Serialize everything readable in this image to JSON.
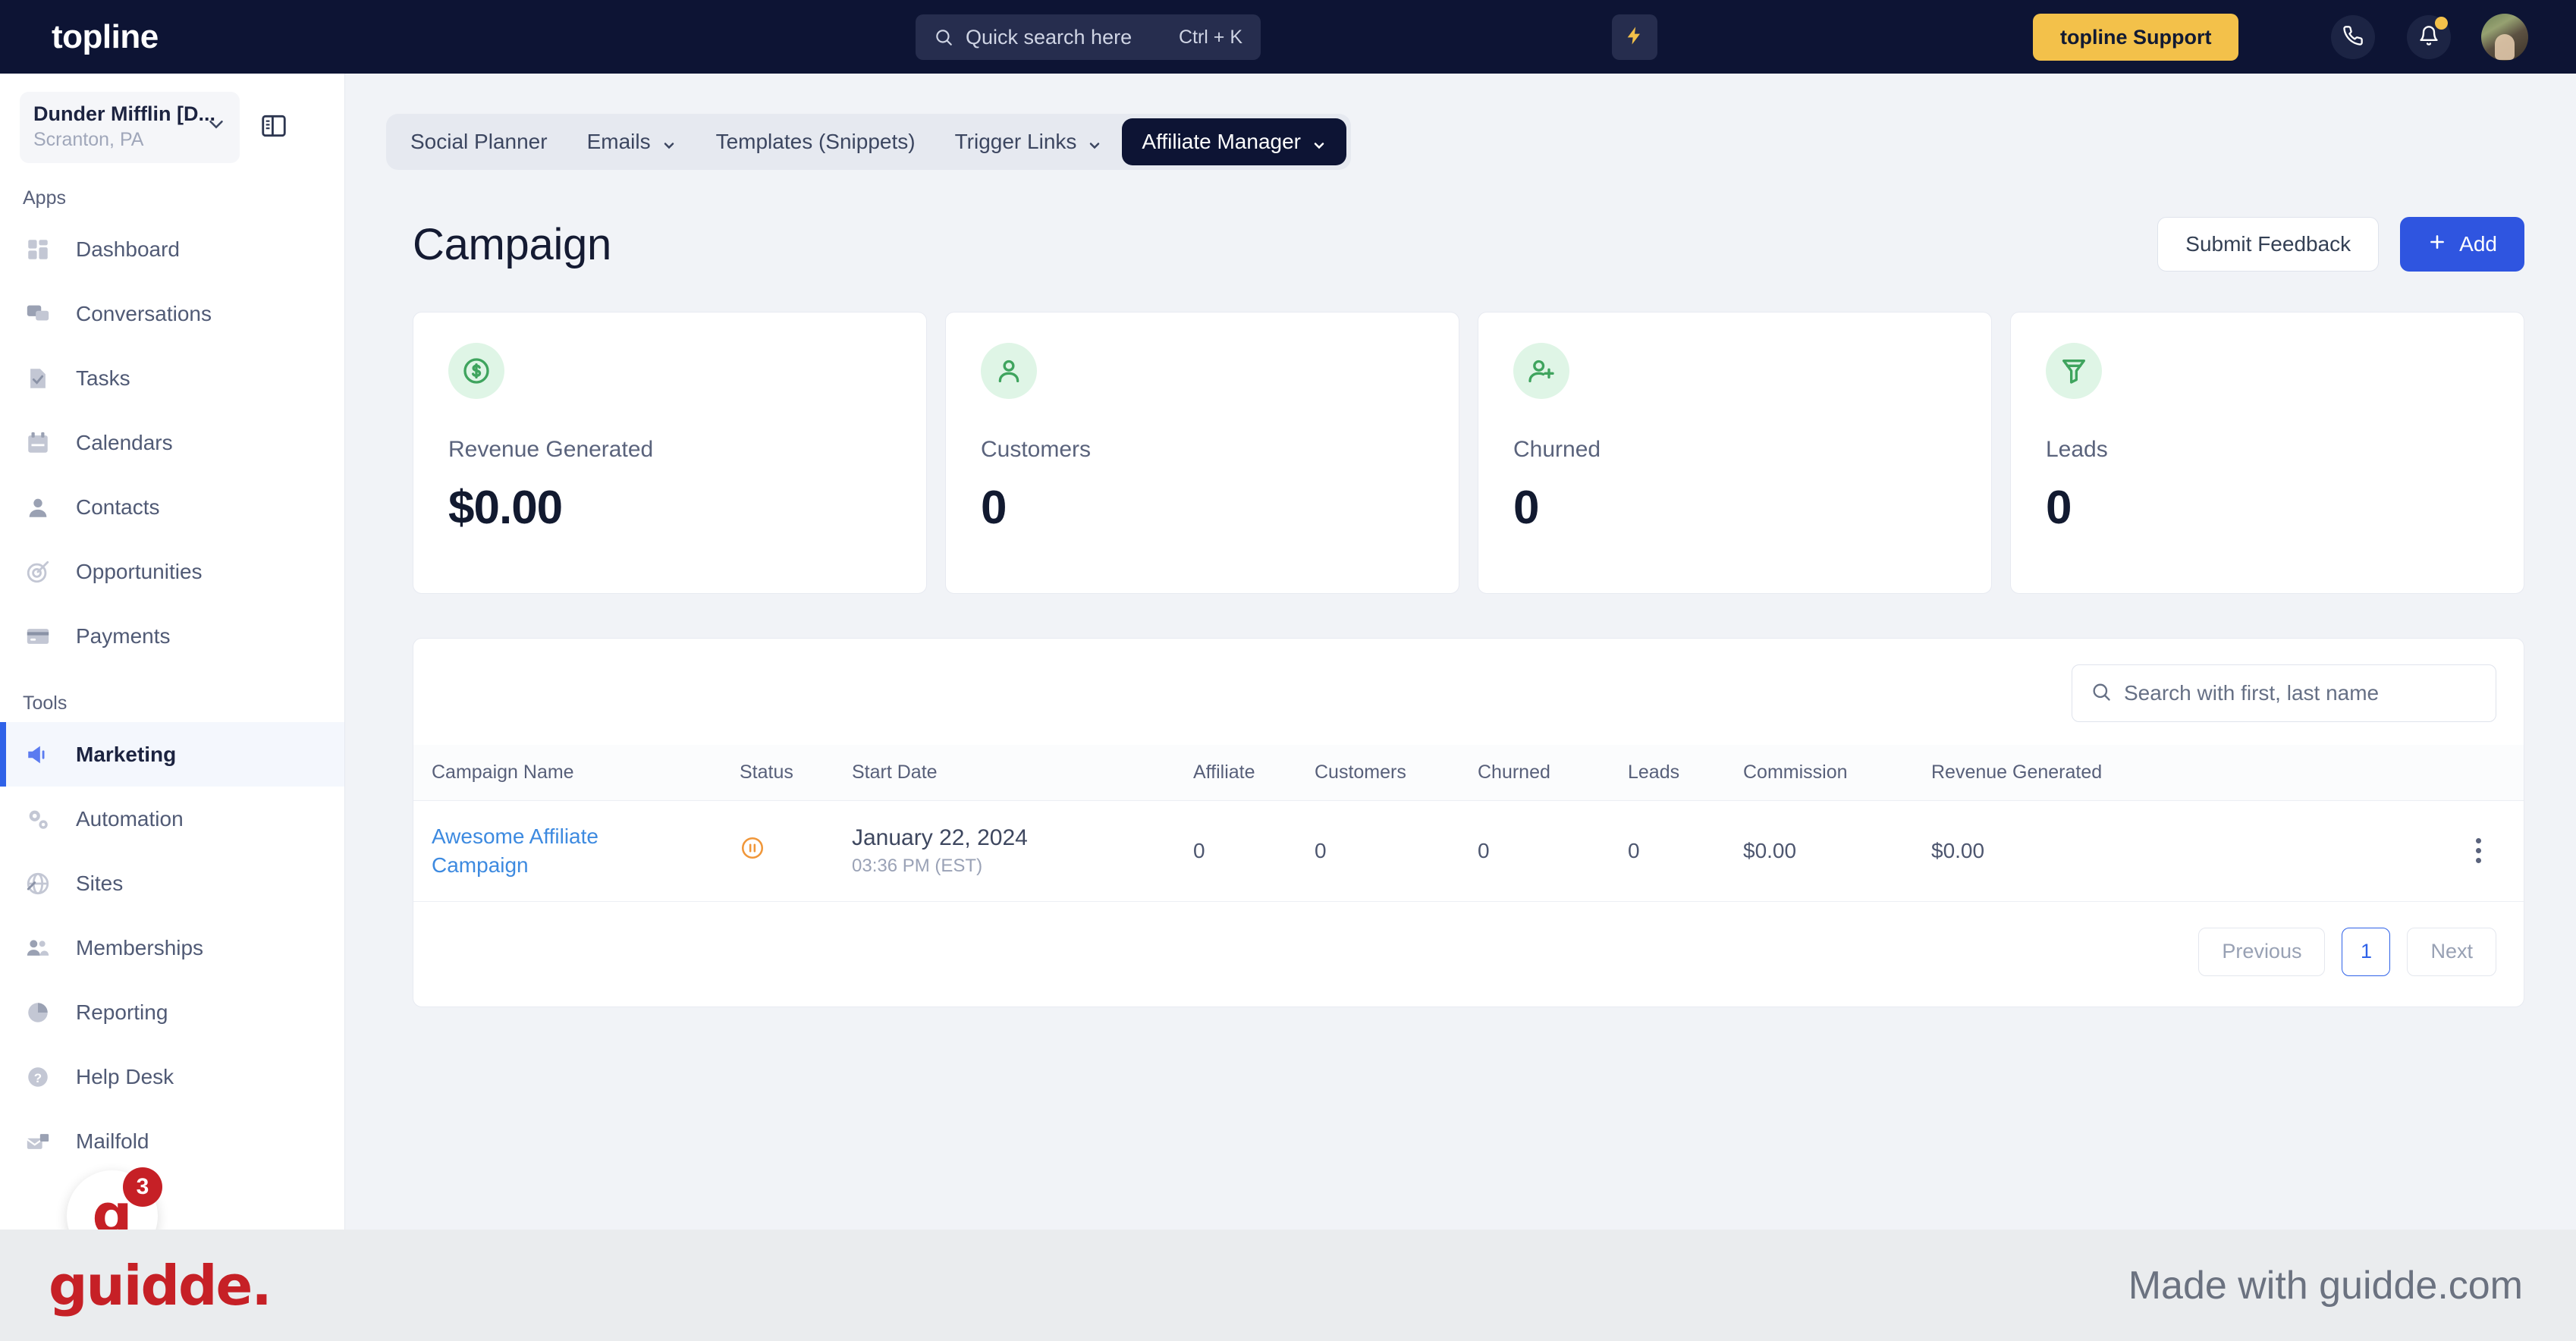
{
  "topbar": {
    "logo": "topline",
    "search_placeholder": "Quick search here",
    "search_value": "",
    "search_shortcut": "Ctrl + K",
    "bolt_icon": "bolt-icon",
    "support_label": "topline Support",
    "phone_icon": "phone-icon",
    "bell_icon": "bell-icon",
    "avatar_label": "user-avatar",
    "bg_color": "#0d1434",
    "support_color": "#f3c14a"
  },
  "sidebar": {
    "location_name": "Dunder Mifflin [D...",
    "location_sub": "Scranton, PA",
    "panel_toggle_icon": "sidebar-toggle-icon",
    "sections": [
      {
        "label": "Apps",
        "items": [
          {
            "label": "Dashboard",
            "icon": "dashboard-icon",
            "active": false
          },
          {
            "label": "Conversations",
            "icon": "chat-icon",
            "active": false
          },
          {
            "label": "Tasks",
            "icon": "task-check-icon",
            "active": false
          },
          {
            "label": "Calendars",
            "icon": "calendar-icon",
            "active": false
          },
          {
            "label": "Contacts",
            "icon": "person-icon",
            "active": false
          },
          {
            "label": "Opportunities",
            "icon": "target-icon",
            "active": false
          },
          {
            "label": "Payments",
            "icon": "credit-card-icon",
            "active": false
          }
        ]
      },
      {
        "label": "Tools",
        "items": [
          {
            "label": "Marketing",
            "icon": "megaphone-icon",
            "active": true
          },
          {
            "label": "Automation",
            "icon": "gears-icon",
            "active": false
          },
          {
            "label": "Sites",
            "icon": "globe-arrow-icon",
            "active": false
          },
          {
            "label": "Memberships",
            "icon": "people-plus-icon",
            "active": false
          },
          {
            "label": "Reporting",
            "icon": "pie-chart-icon",
            "active": false
          },
          {
            "label": "Help Desk",
            "icon": "question-circle-icon",
            "active": false
          },
          {
            "label": "Mailfold",
            "icon": "mail-stack-icon",
            "active": false
          }
        ]
      }
    ],
    "widget": {
      "letter": "g",
      "badge": "3",
      "color": "#c62026"
    }
  },
  "tabs": [
    {
      "label": "Social Planner",
      "caret": false,
      "active": false
    },
    {
      "label": "Emails",
      "caret": true,
      "active": false
    },
    {
      "label": "Templates (Snippets)",
      "caret": false,
      "active": false
    },
    {
      "label": "Trigger Links",
      "caret": true,
      "active": false
    },
    {
      "label": "Affiliate Manager",
      "caret": true,
      "active": true
    }
  ],
  "page": {
    "title": "Campaign",
    "feedback_label": "Submit Feedback",
    "add_label": "Add",
    "add_icon": "plus-icon"
  },
  "kpi_cards": [
    {
      "label": "Revenue Generated",
      "value": "$0.00",
      "icon": "dollar-circle-icon"
    },
    {
      "label": "Customers",
      "value": "0",
      "icon": "person-icon"
    },
    {
      "label": "Churned",
      "value": "0",
      "icon": "person-plus-icon"
    },
    {
      "label": "Leads",
      "value": "0",
      "icon": "funnel-icon"
    }
  ],
  "table": {
    "search_placeholder": "Search with first, last name",
    "search_value": "",
    "search_icon": "search-icon",
    "columns": [
      "Campaign Name",
      "Status",
      "Start Date",
      "Affiliate",
      "Customers",
      "Churned",
      "Leads",
      "Commission",
      "Revenue Generated"
    ],
    "rows": [
      {
        "campaign_name": "Awesome Affiliate Campaign",
        "status_icon": "pause-circle-icon",
        "status_color": "#f0973a",
        "start_date": "January 22, 2024",
        "start_time": "03:36 PM (EST)",
        "affiliate": "0",
        "customers": "0",
        "churned": "0",
        "leads": "0",
        "commission": "$0.00",
        "revenue_generated": "$0.00",
        "menu_icon": "kebab-menu-icon"
      }
    ],
    "pagination": {
      "previous": "Previous",
      "current_page": "1",
      "next": "Next"
    }
  },
  "footer": {
    "logo": "guidde.",
    "made_with": "Made with guidde.com",
    "logo_color": "#c62026"
  }
}
